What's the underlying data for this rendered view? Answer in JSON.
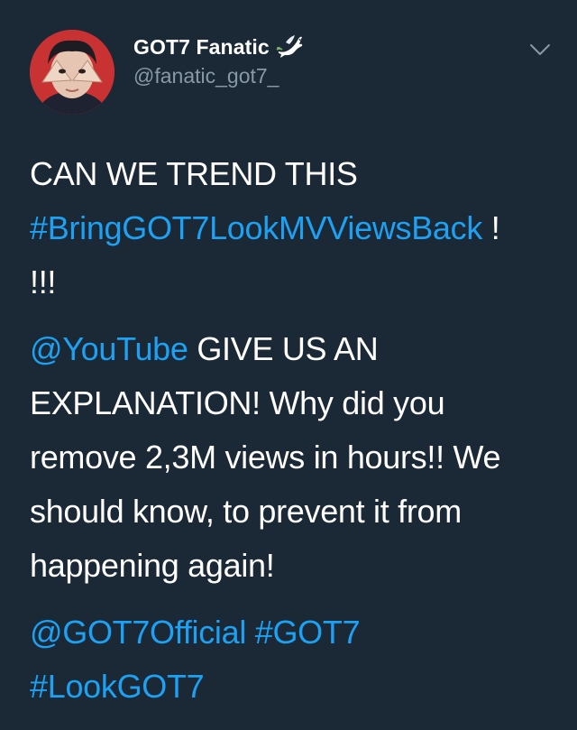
{
  "author": {
    "display_name": "GOT7 Fanatic",
    "handle": "@fanatic_got7_",
    "badge_icon": "dove-icon"
  },
  "menu": {
    "icon": "chevron-down-icon"
  },
  "tweet": {
    "p1": {
      "line1": "CAN WE TREND THIS",
      "hashtag": "#BringGOT7LookMVViewsBack",
      "after_hashtag": " !",
      "line3": "!!!"
    },
    "p2": {
      "mention": "@YouTube",
      "line1_rest": " GIVE US AN",
      "line2": "EXPLANATION! Why did you",
      "line3": "remove 2,3M views in hours!! We",
      "line4": "should know, to prevent it from",
      "line5": "happening again!"
    },
    "p3": {
      "mention": "@GOT7Official",
      "space": " ",
      "hashtag1": "#GOT7",
      "hashtag2": "#LookGOT7"
    }
  },
  "colors": {
    "background": "#1b2836",
    "link": "#1da1f2",
    "secondary_text": "#8899a6",
    "primary_text": "#ffffff"
  }
}
